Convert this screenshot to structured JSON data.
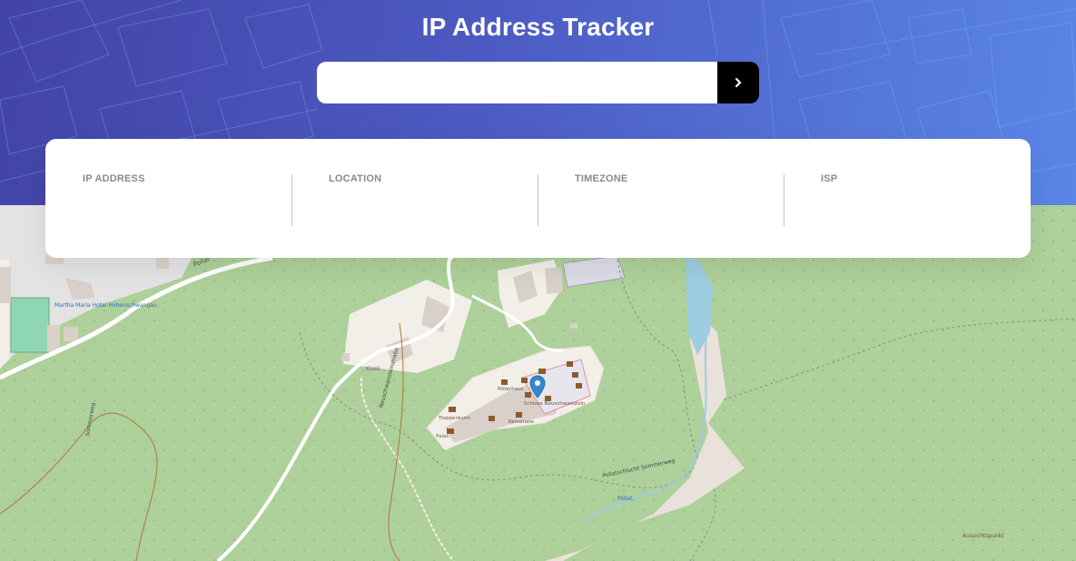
{
  "header": {
    "title": "IP Address Tracker"
  },
  "search": {
    "value": "",
    "placeholder": "",
    "submit_icon": "chevron-right-icon"
  },
  "stats": [
    {
      "label": "IP ADDRESS",
      "value": ""
    },
    {
      "label": "LOCATION",
      "value": ""
    },
    {
      "label": "TIMEZONE",
      "value": ""
    },
    {
      "label": "ISP",
      "value": ""
    }
  ],
  "map": {
    "labels": {
      "kiosk": "Kiosk",
      "hotel": "Martha Maria Hotel Hohenschwangau",
      "schloss": "Schloss Neuschwanstein",
      "ritterhaus": "Ritterhaus",
      "kemenate": "Kemenate",
      "treppenturm": "Treppenturm",
      "palas": "Palas",
      "road_pollat": "Pollatschlucht Sommerweg",
      "road_neuschwanstein": "Neuschwansteinstraße",
      "road_sommerweg": "Sommerweg",
      "stream": "Pöllat",
      "aussichtspunkt": "Aussichtspunkt"
    },
    "marker_icon": "location-pin-icon"
  },
  "colors": {
    "accent": "#000000",
    "hero_start": "#4343a6",
    "hero_end": "#5a86e8",
    "forest": "#aed09a",
    "marker": "#3388cc"
  }
}
